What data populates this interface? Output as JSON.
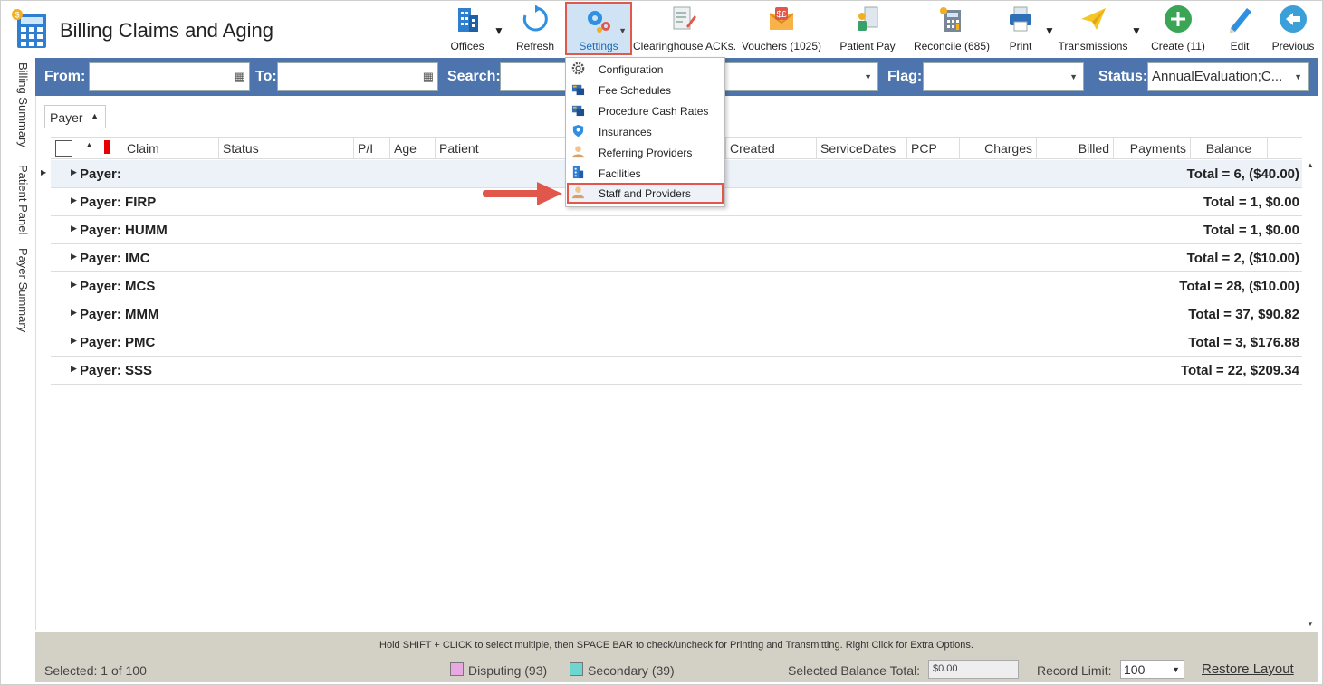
{
  "app": {
    "title": "Billing Claims and Aging"
  },
  "toolbar": {
    "offices": "Offices",
    "refresh": "Refresh",
    "settings": "Settings",
    "clearinghouse": "Clearinghouse ACKs.",
    "vouchers": "Vouchers (1025)",
    "patient_pay": "Patient Pay",
    "reconcile": "Reconcile (685)",
    "print": "Print",
    "transmissions": "Transmissions",
    "create": "Create (11)",
    "edit": "Edit",
    "previous": "Previous"
  },
  "filters": {
    "from_label": "From:",
    "to_label": "To:",
    "search_label": "Search:",
    "flag_label": "Flag:",
    "status_label": "Status:",
    "status_value": "AnnualEvaluation;C..."
  },
  "side_tabs": [
    "Billing Summary",
    "Patient Panel",
    "Payer Summary"
  ],
  "grid": {
    "group_by": "Payer",
    "columns": [
      "Claim",
      "Status",
      "P/I",
      "Age",
      "Patient",
      "Created",
      "ServiceDates",
      "PCP",
      "Charges",
      "Billed",
      "Payments",
      "Balance"
    ],
    "groups": [
      {
        "label": "Payer:",
        "total": "Total = 6,  ($40.00)"
      },
      {
        "label": "Payer: FIRP",
        "total": "Total = 1,  $0.00"
      },
      {
        "label": "Payer: HUMM",
        "total": "Total = 1,  $0.00"
      },
      {
        "label": "Payer: IMC",
        "total": "Total = 2,  ($10.00)"
      },
      {
        "label": "Payer: MCS",
        "total": "Total = 28,  ($10.00)"
      },
      {
        "label": "Payer: MMM",
        "total": "Total = 37,  $90.82"
      },
      {
        "label": "Payer: PMC",
        "total": "Total = 3,  $176.88"
      },
      {
        "label": "Payer: SSS",
        "total": "Total = 22,  $209.34"
      }
    ]
  },
  "settings_menu": {
    "items": [
      {
        "label": "Configuration",
        "icon": "gear-icon"
      },
      {
        "label": "Fee Schedules",
        "icon": "fee-schedule-icon"
      },
      {
        "label": "Procedure Cash Rates",
        "icon": "cash-rates-icon"
      },
      {
        "label": "Insurances",
        "icon": "shield-icon"
      },
      {
        "label": "Referring Providers",
        "icon": "provider-person-icon"
      },
      {
        "label": "Facilities",
        "icon": "building-icon"
      },
      {
        "label": "Staff and Providers",
        "icon": "staff-person-icon"
      }
    ],
    "highlighted": "Staff and Providers"
  },
  "footer": {
    "hint": "Hold SHIFT + CLICK to select multiple, then SPACE BAR to check/uncheck for Printing and Transmitting. Right Click for Extra Options.",
    "selected": "Selected: 1 of 100",
    "disputing": "Disputing (93)",
    "secondary": "Secondary (39)",
    "selected_balance_label": "Selected Balance Total:",
    "selected_balance_value": "$0.00",
    "record_limit_label": "Record Limit:",
    "record_limit_value": "100",
    "restore_layout": "Restore Layout"
  },
  "colors": {
    "filter_bar": "#4d74ad",
    "highlight_border": "#e2574c",
    "footer_bg": "#d3d0c6",
    "disputing_swatch": "#e8a8e0",
    "secondary_swatch": "#6dd6d0",
    "flag_red": "#e60000"
  }
}
